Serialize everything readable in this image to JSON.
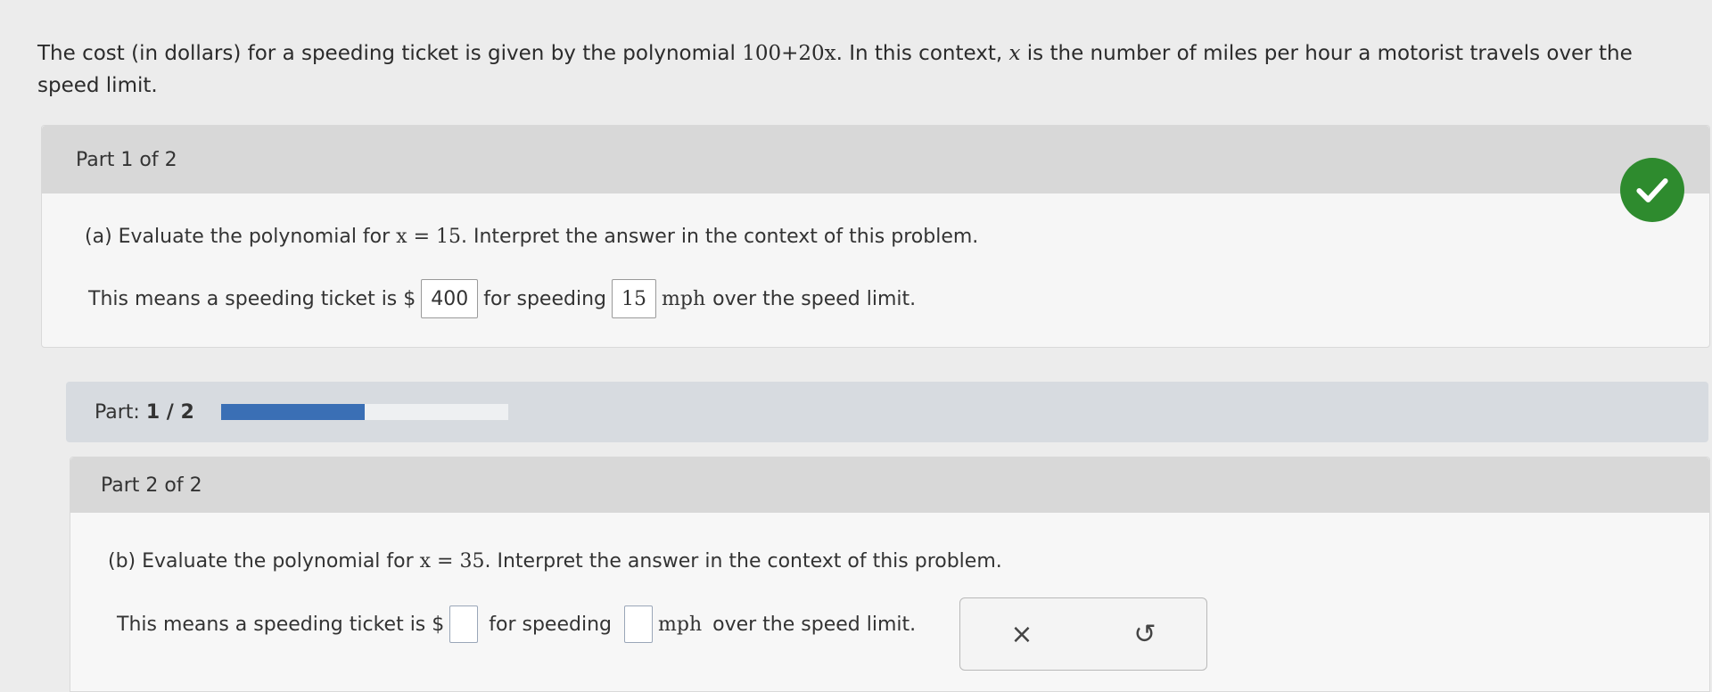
{
  "problem": {
    "text_before": "The cost (in dollars) for a speeding ticket is given by the polynomial ",
    "polynomial": "100+20x",
    "text_middle": ". In this context, ",
    "variable": "x",
    "text_after": " is the number of miles per hour a motorist travels over the speed limit."
  },
  "part1": {
    "header": "Part 1 of 2",
    "question_prefix": "(a) Evaluate the polynomial for ",
    "question_eq": "x = 15",
    "question_suffix": ". Interpret the answer in the context of this problem.",
    "answer_prefix": "This means a speeding ticket is $",
    "answer_cost": "400",
    "answer_middle": "for speeding",
    "answer_speed": "15",
    "answer_unit": "mph",
    "answer_suffix": "over the speed limit.",
    "status": "correct"
  },
  "progress": {
    "label": "Part:",
    "value": "1 / 2",
    "fraction": 0.5
  },
  "part2": {
    "header": "Part 2 of 2",
    "question_prefix": "(b) Evaluate the polynomial for ",
    "question_eq": "x = 35",
    "question_suffix": ". Interpret the answer in the context of this problem.",
    "answer_prefix": "This means a speeding ticket is $",
    "answer_cost": "",
    "answer_middle": "for speeding",
    "answer_speed": "",
    "answer_unit": "mph",
    "answer_suffix": "over the speed limit."
  },
  "actions": {
    "clear_icon": "×",
    "undo_icon": "↺"
  },
  "colors": {
    "check": "#2e8b2e",
    "progress_fill": "#3a6fb5"
  }
}
